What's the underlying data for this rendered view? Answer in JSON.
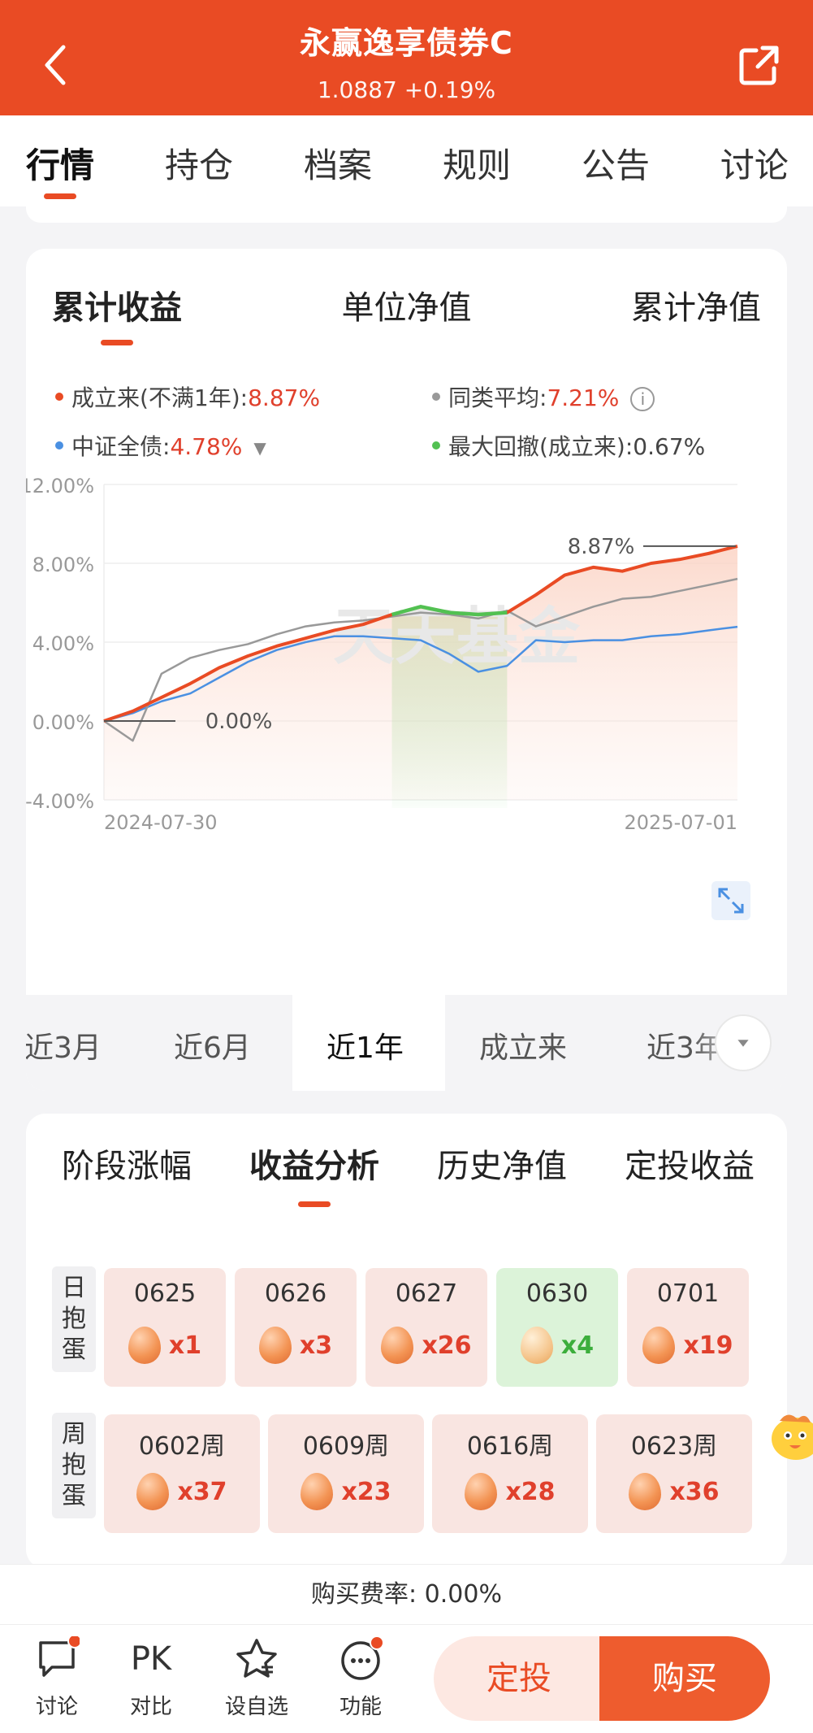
{
  "header": {
    "title": "永赢逸享债券C",
    "subtitle": "1.0887 +0.19%",
    "back_icon": "chevron-left-icon",
    "share_icon": "share-icon"
  },
  "top_tabs": [
    {
      "label": "行情",
      "active": true
    },
    {
      "label": "持仓"
    },
    {
      "label": "档案"
    },
    {
      "label": "规则"
    },
    {
      "label": "公告"
    },
    {
      "label": "讨论"
    }
  ],
  "chart_card": {
    "tabs": [
      {
        "label": "累计收益",
        "active": true
      },
      {
        "label": "单位净值"
      },
      {
        "label": "累计净值"
      }
    ],
    "legend": {
      "since_inception": {
        "label": "成立来(不满1年):",
        "value": "8.87%",
        "color": "#e94b24"
      },
      "peer_average": {
        "label": "同类平均:",
        "value": "7.21%",
        "color": "#999999"
      },
      "benchmark": {
        "label": "中证全债:",
        "value": "4.78%",
        "color": "#4a90e2"
      },
      "max_drawdown": {
        "label": "最大回撤(成立来):",
        "value": "0.67%",
        "color": "#52c152"
      }
    },
    "watermark": "天天基金"
  },
  "chart_data": {
    "type": "line",
    "ylim": [
      -4,
      12
    ],
    "y_ticks": [
      "12.00%",
      "8.00%",
      "4.00%",
      "0.00%",
      "-4.00%"
    ],
    "x_labels": [
      "2024-07-30",
      "2025-07-01"
    ],
    "end_label": "8.87%",
    "start_label": "0.00%",
    "series": [
      {
        "name": "成立来",
        "color": "#e94b24",
        "values": [
          0.0,
          0.5,
          1.2,
          1.9,
          2.7,
          3.3,
          3.8,
          4.2,
          4.6,
          4.9,
          5.4,
          5.8,
          5.5,
          5.4,
          5.5,
          6.4,
          7.4,
          7.8,
          7.6,
          8.0,
          8.2,
          8.5,
          8.87
        ]
      },
      {
        "name": "同类平均",
        "color": "#999999",
        "values": [
          0.0,
          -1.0,
          2.4,
          3.2,
          3.6,
          3.9,
          4.4,
          4.8,
          5.0,
          5.1,
          5.3,
          5.5,
          5.4,
          5.2,
          5.6,
          4.8,
          5.3,
          5.8,
          6.2,
          6.3,
          6.6,
          6.9,
          7.21
        ]
      },
      {
        "name": "中证全债",
        "color": "#4a90e2",
        "values": [
          0.0,
          0.4,
          1.0,
          1.4,
          2.2,
          3.0,
          3.6,
          4.0,
          4.3,
          4.3,
          4.2,
          4.1,
          3.4,
          2.5,
          2.8,
          4.1,
          4.0,
          4.1,
          4.1,
          4.3,
          4.4,
          4.6,
          4.78
        ]
      }
    ],
    "max_drawdown_range": [
      10,
      14
    ]
  },
  "periods": [
    {
      "label": "近3月"
    },
    {
      "label": "近6月"
    },
    {
      "label": "近1年",
      "active": true
    },
    {
      "label": "成立来"
    },
    {
      "label": "近3年"
    }
  ],
  "analysis": {
    "tabs": [
      {
        "label": "阶段涨幅"
      },
      {
        "label": "收益分析",
        "active": true
      },
      {
        "label": "历史净值"
      },
      {
        "label": "定投收益"
      }
    ],
    "daily_label": "日抱蛋",
    "weekly_label": "周抱蛋",
    "daily": [
      {
        "date": "0625",
        "count": "x1",
        "type": "egg"
      },
      {
        "date": "0626",
        "count": "x3",
        "type": "egg"
      },
      {
        "date": "0627",
        "count": "x26",
        "type": "egg"
      },
      {
        "date": "0630",
        "count": "x4",
        "type": "hatched"
      },
      {
        "date": "0701",
        "count": "x19",
        "type": "egg"
      }
    ],
    "weekly": [
      {
        "date": "0602周",
        "count": "x37",
        "type": "egg"
      },
      {
        "date": "0609周",
        "count": "x23",
        "type": "egg"
      },
      {
        "date": "0616周",
        "count": "x28",
        "type": "egg"
      },
      {
        "date": "0623周",
        "count": "x36",
        "type": "egg"
      }
    ]
  },
  "fee": {
    "text": "购买费率: 0.00%"
  },
  "bottom_nav": [
    {
      "label": "讨论",
      "icon": "chat-bubble-icon",
      "badge": true
    },
    {
      "label": "对比",
      "icon": "pk-icon",
      "text": "PK"
    },
    {
      "label": "设自选",
      "icon": "star-icon"
    },
    {
      "label": "功能",
      "icon": "more-icon",
      "badge": true
    }
  ],
  "actions": {
    "dingtou": "定投",
    "buy": "购买"
  }
}
